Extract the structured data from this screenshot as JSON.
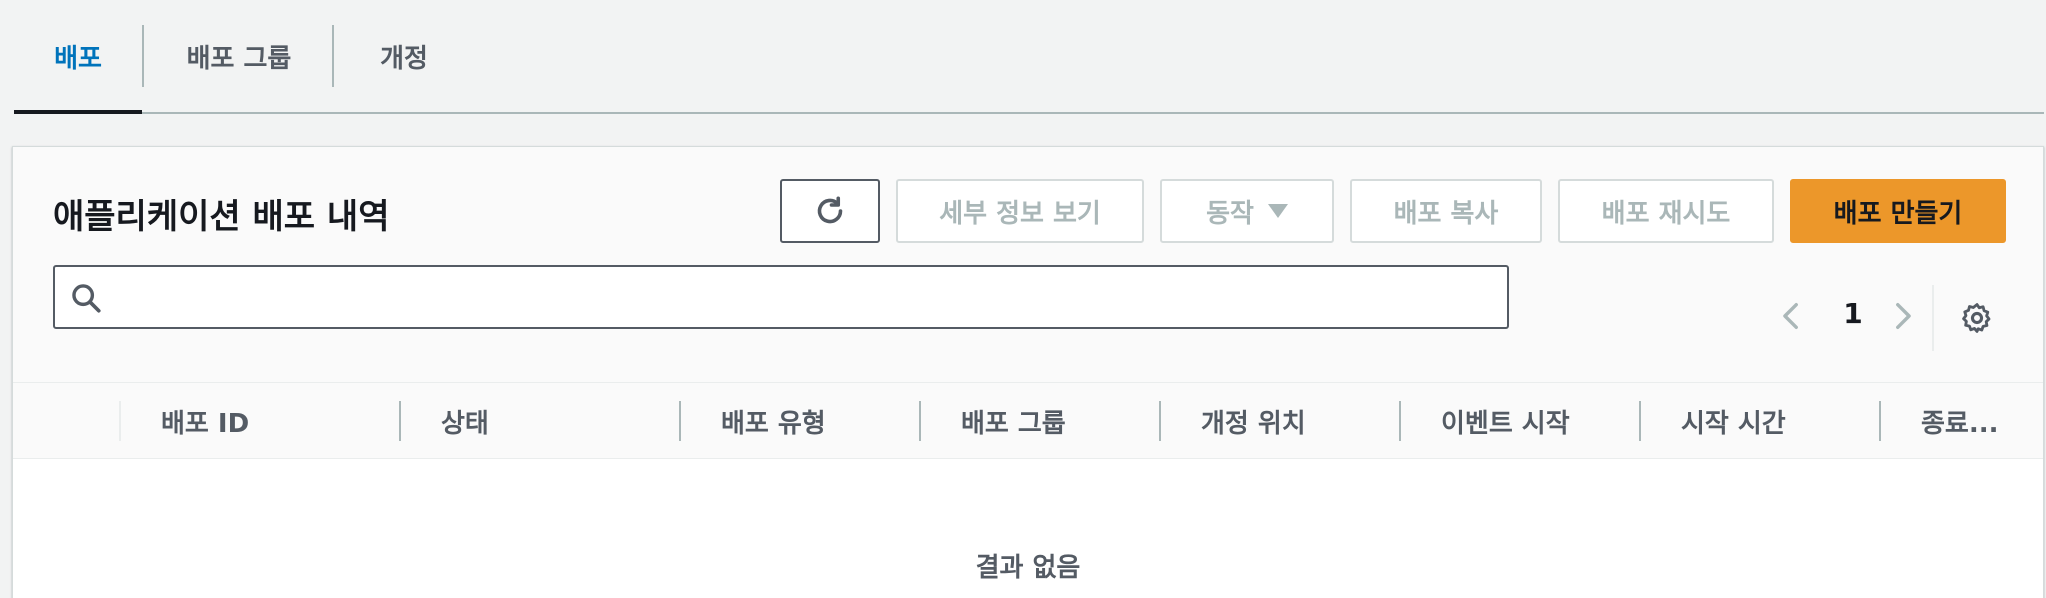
{
  "tabs": [
    {
      "label": "배포",
      "active": true
    },
    {
      "label": "배포 그룹",
      "active": false
    },
    {
      "label": "개정",
      "active": false
    }
  ],
  "panel": {
    "title": "애플리케이션 배포 내역",
    "buttons": {
      "view_details": "세부 정보 보기",
      "actions": "동작",
      "copy_deployment": "배포 복사",
      "retry_deployment": "배포 재시도",
      "create_deployment": "배포 만들기"
    },
    "search": {
      "placeholder": "",
      "value": ""
    },
    "pagination": {
      "current_page": "1"
    },
    "columns": [
      "배포 ID",
      "상태",
      "배포 유형",
      "배포 그룹",
      "개정 위치",
      "이벤트 시작",
      "시작 시간",
      "종료..."
    ],
    "empty_message": "결과 없음"
  },
  "colors": {
    "accent_tab": "#0073bb",
    "primary_button": "#ec972a",
    "disabled_text": "#aab7b8"
  }
}
